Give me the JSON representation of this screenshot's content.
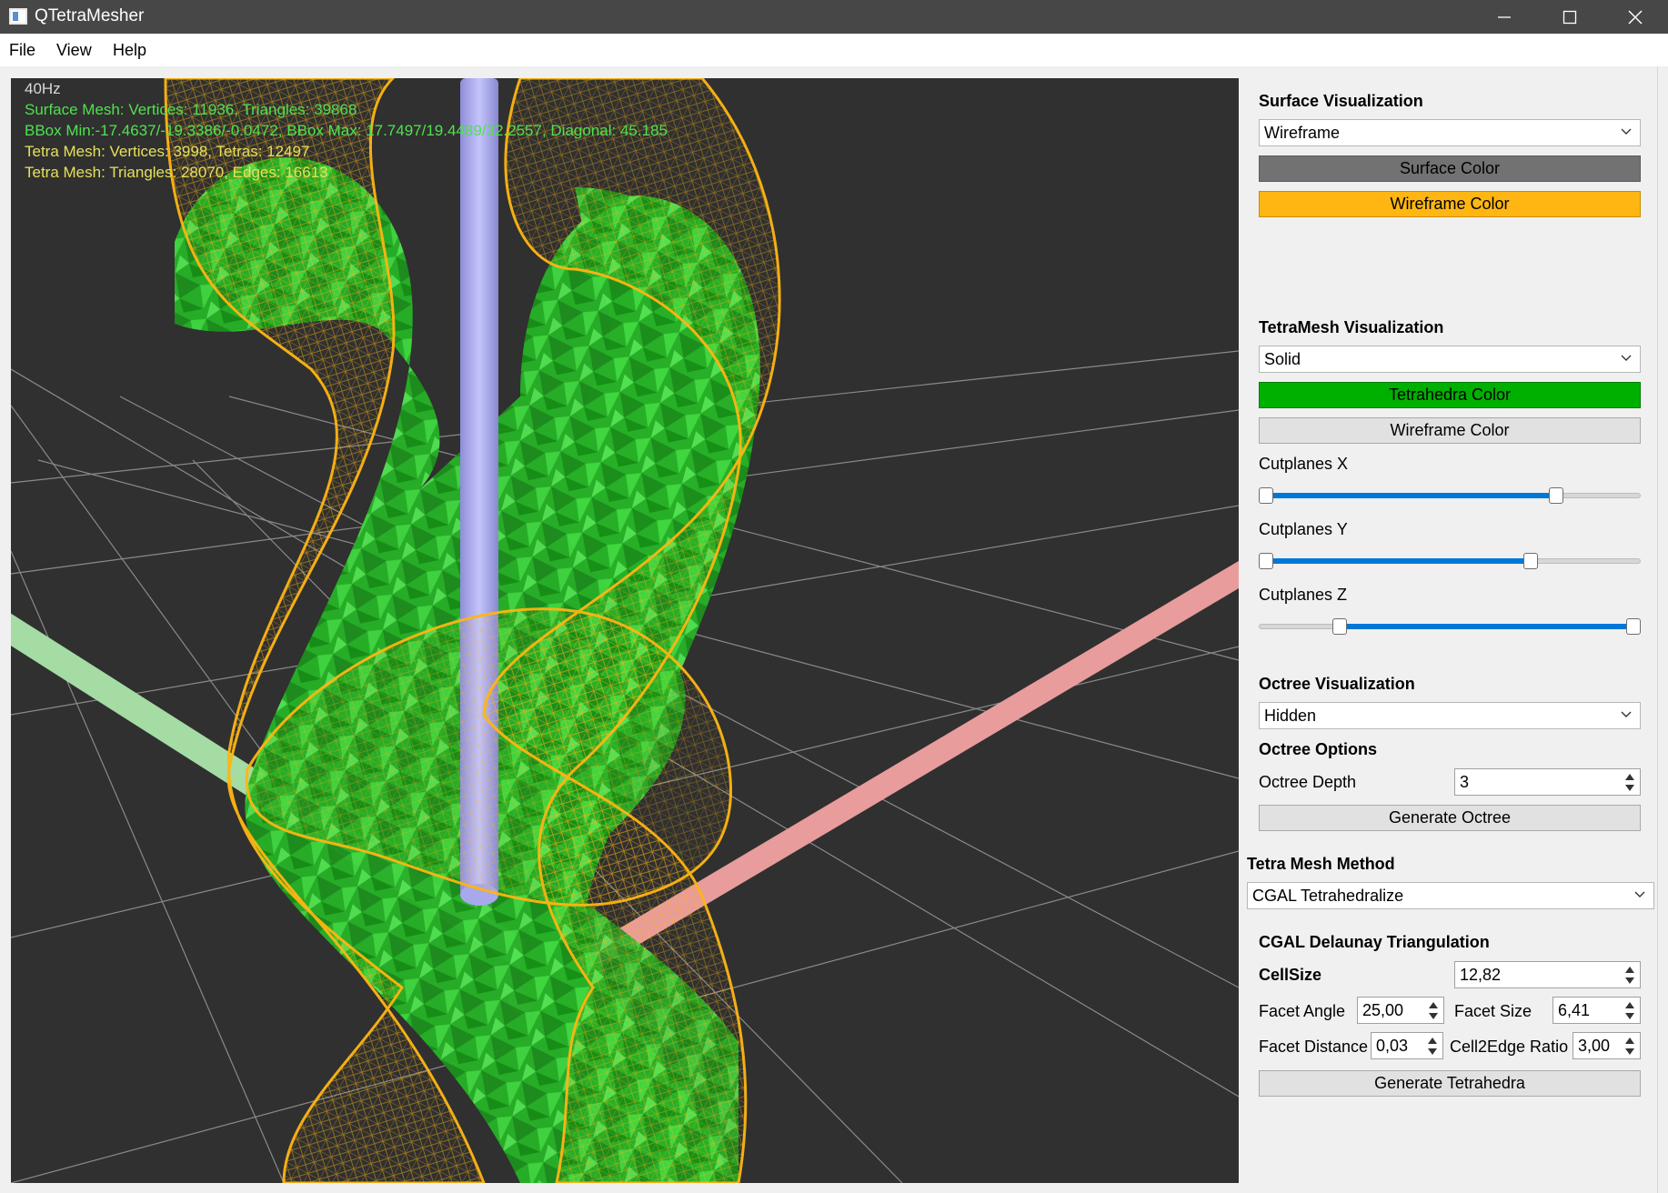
{
  "window": {
    "title": "QTetraMesher"
  },
  "menu": [
    "File",
    "View",
    "Help"
  ],
  "viewport": {
    "fps": "40Hz",
    "overlay": [
      {
        "text": "Surface Mesh: Vertices: 11936, Triangles: 39868",
        "color": "#4fe14f"
      },
      {
        "text": "BBox Min:-17.4637/-19.3386/-0.0472, BBox Max: 17.7497/19.4489/32.2557, Diagonal: 45.185",
        "color": "#4fe14f"
      },
      {
        "text": "Tetra Mesh: Vertices: 3998, Tetras: 12497",
        "color": "#e5e05a"
      },
      {
        "text": "Tetra Mesh: Triangles: 28070, Edges: 16613",
        "color": "#e5e05a"
      }
    ],
    "colors": {
      "background": "#303030",
      "grid": "#8a8a8a",
      "wireframe": "#ffb612",
      "tetra": "#22b522",
      "axis_x": "#e89c9c",
      "axis_y": "#a4dca4",
      "axis_z": "#b0b0ee"
    }
  },
  "panel": {
    "surface": {
      "title": "Surface Visualization",
      "mode": "Wireframe",
      "surface_color_label": "Surface Color",
      "surface_color": "#727272",
      "wireframe_color_label": "Wireframe Color",
      "wireframe_color": "#ffb612"
    },
    "tetra": {
      "title": "TetraMesh Visualization",
      "mode": "Solid",
      "tetra_color_label": "Tetrahedra Color",
      "tetra_color": "#00b000",
      "wireframe_color_label": "Wireframe Color",
      "cutplanes": [
        {
          "label": "Cutplanes X",
          "low": 0.0,
          "high": 0.79
        },
        {
          "label": "Cutplanes Y",
          "low": 0.0,
          "high": 0.72
        },
        {
          "label": "Cutplanes Z",
          "low": 0.2,
          "high": 1.0
        }
      ]
    },
    "octree": {
      "title": "Octree Visualization",
      "mode": "Hidden",
      "options_title": "Octree Options",
      "depth_label": "Octree Depth",
      "depth_value": "3",
      "generate_label": "Generate Octree"
    },
    "method": {
      "title": "Tetra Mesh Method",
      "value": "CGAL Tetrahedralize"
    },
    "cgal": {
      "title": "CGAL Delaunay Triangulation",
      "cellsize_label": "CellSize",
      "cellsize_value": "12,82",
      "facet_angle_label": "Facet Angle",
      "facet_angle_value": "25,00",
      "facet_size_label": "Facet Size",
      "facet_size_value": "6,41",
      "facet_distance_label": "Facet Distance",
      "facet_distance_value": "0,03",
      "cell2edge_label": "Cell2Edge Ratio",
      "cell2edge_value": "3,00",
      "generate_label": "Generate Tetrahedra"
    }
  }
}
